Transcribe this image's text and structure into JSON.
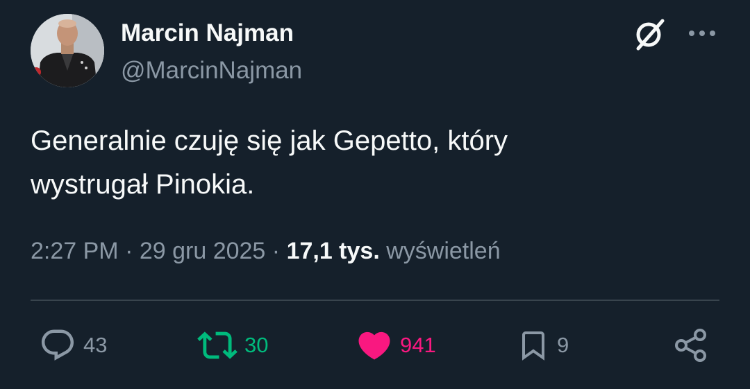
{
  "author": {
    "display_name": "Marcin Najman",
    "handle": "@MarcinNajman"
  },
  "header_icons": [
    "grok-icon",
    "more-icon"
  ],
  "tweet": {
    "text_line1": "Generalnie czuję się jak Gepetto, który",
    "text_line2": "wystrugał Pinokia."
  },
  "meta": {
    "time": "2:27 PM",
    "separator": " · ",
    "date": "29 gru 2025",
    "views_count": "17,1 tys.",
    "views_label": "wyświetleń"
  },
  "actions": {
    "replies": "43",
    "retweets": "30",
    "likes": "941",
    "bookmarks": "9"
  },
  "colors": {
    "background": "#15202b",
    "text": "#f7f9f9",
    "secondary": "#8b98a5",
    "retweet": "#00ba7c",
    "like": "#f91880",
    "divider": "#38444d"
  }
}
